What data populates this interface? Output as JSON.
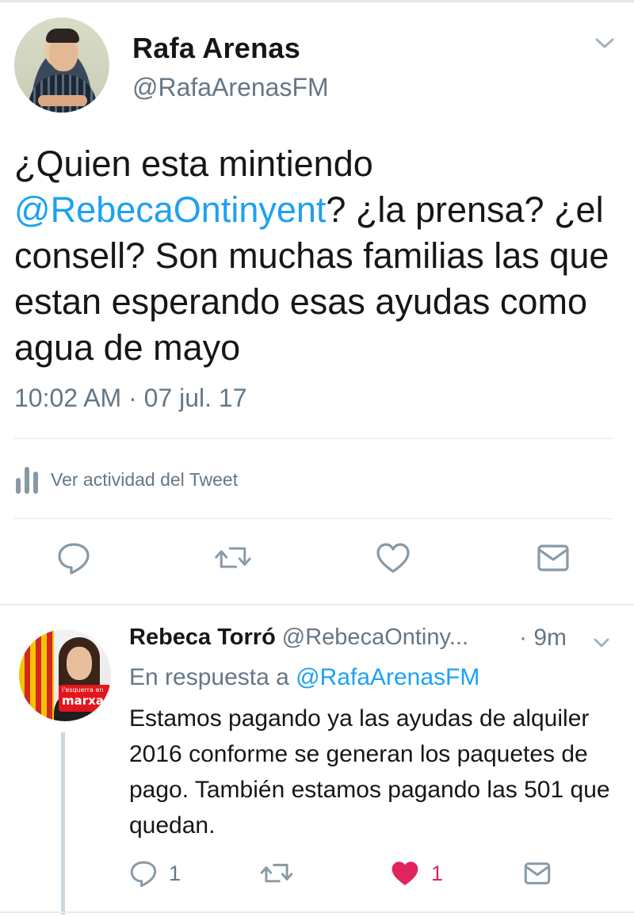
{
  "main_tweet": {
    "author_name": "Rafa Arenas",
    "author_handle": "@RafaArenasFM",
    "text_part1": "¿Quien esta mintiendo ",
    "mention": "@RebecaOntinyent",
    "text_part2": "? ¿la prensa? ¿el consell? Son muchas familias las que estan esperando esas ayudas como agua de mayo",
    "timestamp": "10:02 AM · 07 jul. 17",
    "activity_label": "Ver actividad del Tweet",
    "icons": [
      "reply-icon",
      "retweet-icon",
      "like-icon",
      "message-icon"
    ]
  },
  "reply_tweet": {
    "author_name": "Rebeca Torró",
    "author_handle": "@RebecaOntiny...",
    "time": "· 9m",
    "reply_to_label": "En respuesta a ",
    "reply_to_handle": "@RafaArenasFM",
    "text": "Estamos pagando ya las ayudas de alquiler 2016 conforme se generan los paquetes de pago. También estamos pagando las 501 que quedan.",
    "reply_count": "1",
    "like_count": "1",
    "liked": true,
    "avatar_banner_line1": "l'esquerra en",
    "avatar_banner_line2": "marxa"
  },
  "colors": {
    "link": "#1da1f2",
    "secondary_text": "#657786",
    "like_active": "#e0245e",
    "icon": "#8899a6"
  }
}
